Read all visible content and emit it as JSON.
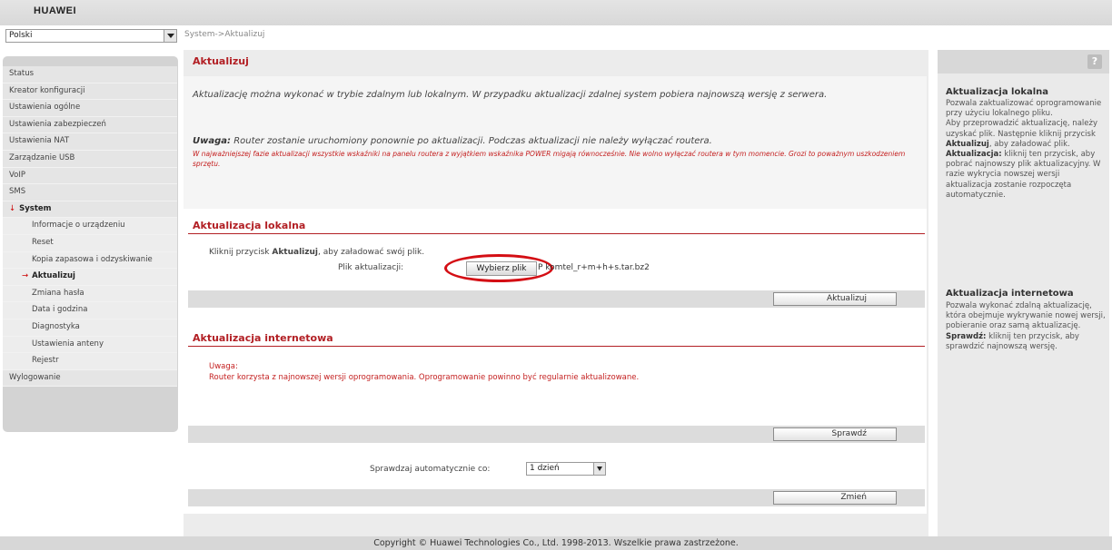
{
  "header": {
    "logo": "HUAWEI"
  },
  "language": {
    "selected": "Polski"
  },
  "breadcrumb": "System->Aktualizuj",
  "sidebar": {
    "items": [
      {
        "label": "Status"
      },
      {
        "label": "Kreator konfiguracji"
      },
      {
        "label": "Ustawienia ogólne"
      },
      {
        "label": "Ustawienia zabezpieczeń"
      },
      {
        "label": "Ustawienia NAT"
      },
      {
        "label": "Zarządzanie USB"
      },
      {
        "label": "VoIP"
      },
      {
        "label": "SMS"
      },
      {
        "label": "System",
        "mark": "↓"
      },
      {
        "label": "Informacje o urządzeniu"
      },
      {
        "label": "Reset"
      },
      {
        "label": "Kopia zapasowa i odzyskiwanie"
      },
      {
        "label": "Aktualizuj",
        "mark": "→"
      },
      {
        "label": "Zmiana hasła"
      },
      {
        "label": "Data i godzina"
      },
      {
        "label": "Diagnostyka"
      },
      {
        "label": "Ustawienia anteny"
      },
      {
        "label": "Rejestr"
      },
      {
        "label": "Wylogowanie"
      }
    ]
  },
  "main": {
    "title": "Aktualizuj",
    "intro": "Aktualizację można wykonać w trybie zdalnym lub lokalnym. W przypadku aktualizacji zdalnej system pobiera najnowszą wersję z serwera.",
    "warning_label": "Uwaga:",
    "warning_text": "Router zostanie uruchomiony ponownie po aktualizacji. Podczas aktualizacji nie należy wyłączać routera.",
    "warning_red": "W najważniejszej fazie aktualizacji wszystkie wskaźniki na panelu routera z wyjątkiem wskaźnika POWER migają równocześnie. Nie wolno wyłączać routera w tym momencie. Grozi to poważnym uszkodzeniem sprzętu.",
    "local": {
      "title": "Aktualizacja lokalna",
      "instruction_pre": "Kliknij przycisk ",
      "instruction_bold": "Aktualizuj",
      "instruction_post": ", aby załadować swój plik.",
      "file_label": "Plik aktualizacji:",
      "choose_button": "Wybierz plik",
      "file_name": "P komtel_r+m+h+s.tar.bz2",
      "update_button": "Aktualizuj"
    },
    "internet": {
      "title": "Aktualizacja internetowa",
      "note_label": "Uwaga:",
      "note_text": "Router korzysta z najnowszej wersji oprogramowania. Oprogramowanie powinno być regularnie aktualizowane.",
      "check_button": "Sprawdź",
      "auto_label": "Sprawdzaj automatycznie co:",
      "auto_value": "1 dzień",
      "change_button": "Zmień"
    }
  },
  "help": {
    "icon": "?",
    "local_title": "Aktualizacja lokalna",
    "local_text_1": "Pozwala zaktualizować oprogramowanie przy użyciu lokalnego pliku.",
    "local_text_2": "Aby przeprowadzić aktualizację, należy uzyskać plik. Następnie kliknij przycisk ",
    "local_text_2_bold": "Aktualizuj",
    "local_text_2_post": ", aby załadować plik.",
    "local_text_3_bold": "Aktualizacja:",
    "local_text_3": " kliknij ten przycisk, aby pobrać najnowszy plik aktualizacyjny. W razie wykrycia nowszej wersji aktualizacja zostanie rozpoczęta automatycznie.",
    "internet_title": "Aktualizacja internetowa",
    "internet_text_1": "Pozwala wykonać zdalną aktualizację, która obejmuje wykrywanie nowej wersji, pobieranie oraz samą aktualizację.",
    "internet_text_2_bold": "Sprawdź:",
    "internet_text_2": " kliknij ten przycisk, aby sprawdzić najnowszą wersję."
  },
  "footer": "Copyright © Huawei Technologies Co., Ltd. 1998-2013. Wszelkie prawa zastrzeżone."
}
